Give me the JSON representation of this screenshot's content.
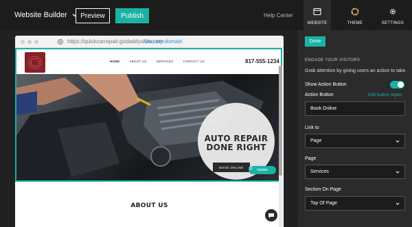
{
  "topbar": {
    "app_title": "Website Builder",
    "preview_label": "Preview",
    "publish_label": "Publish",
    "help_label": "Help Center"
  },
  "browser": {
    "url": "https://quickcarrepair.godaddysites.com",
    "use_domain_label": "Use my domain"
  },
  "site": {
    "nav": [
      "HOME",
      "ABOUT US",
      "SERVICES",
      "CONTACT US"
    ],
    "phone": "817-555-1234",
    "hero_title_line1": "AUTO REPAIR",
    "hero_title_line2": "DONE RIGHT",
    "book_button": "BOOK ONLINE",
    "update_label": "Update",
    "about_title": "ABOUT US"
  },
  "panel": {
    "tabs": [
      {
        "label": "WEBSITE",
        "icon": "browser-window-icon"
      },
      {
        "label": "THEME",
        "icon": "color-wheel-icon"
      },
      {
        "label": "SETTINGS",
        "icon": "gear-icon"
      }
    ],
    "done_label": "Done",
    "section_heading": "ENGAGE YOUR VISITORS",
    "description": "Grab attention by giving users an action to take.",
    "show_action_button_label": "Show Action Button",
    "show_action_button_on": true,
    "action_button_label": "Action Button",
    "edit_styles_label": "Edit button styles",
    "action_button_value": "Book Online",
    "link_to_label": "Link to",
    "link_to_value": "Page",
    "page_label": "Page",
    "page_value": "Services",
    "section_label": "Section On Page",
    "section_value": "Top Of Page"
  },
  "colors": {
    "accent": "#1bb2a3",
    "dark": "#1c1c1c",
    "panel": "#2b2b2b"
  }
}
